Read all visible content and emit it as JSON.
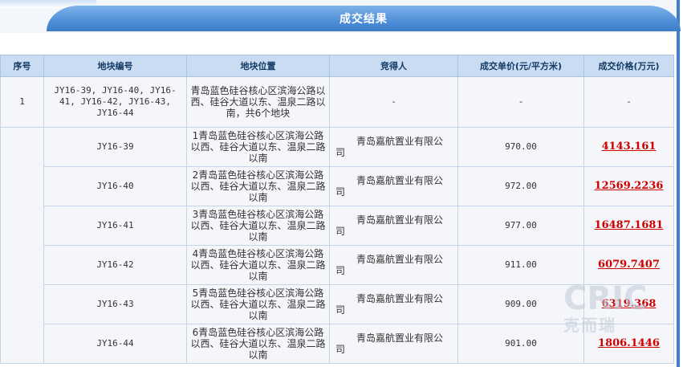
{
  "title": "成交结果",
  "columns": [
    "序号",
    "地块编号",
    "地块位置",
    "竞得人",
    "成交单价(元/平方米)",
    "成交价格(万元)"
  ],
  "summary_row": {
    "index": "1",
    "code": "JY16-39, JY16-40, JY16-41, JY16-42, JY16-43, JY16-44",
    "location": "青岛蓝色硅谷核心区滨海公路以西、硅谷大道以东、温泉二路以南，共6个地块",
    "bidder": "-",
    "unit_price": "-",
    "total_price": "-"
  },
  "rows": [
    {
      "code": "JY16-39",
      "location": "1青岛蓝色硅谷核心区滨海公路以西、硅谷大道以东、温泉二路以南",
      "bidder_name": "青岛嘉航置业有限公",
      "bidder_tail": "司",
      "unit_price": "970.00",
      "total_price": "4143.161"
    },
    {
      "code": "JY16-40",
      "location": "2青岛蓝色硅谷核心区滨海公路以西、硅谷大道以东、温泉二路以南",
      "bidder_name": "青岛嘉航置业有限公",
      "bidder_tail": "司",
      "unit_price": "972.00",
      "total_price": "12569.2236"
    },
    {
      "code": "JY16-41",
      "location": "3青岛蓝色硅谷核心区滨海公路以西、硅谷大道以东、温泉二路以南",
      "bidder_name": "青岛嘉航置业有限公",
      "bidder_tail": "司",
      "unit_price": "977.00",
      "total_price": "16487.1681"
    },
    {
      "code": "JY16-42",
      "location": "4青岛蓝色硅谷核心区滨海公路以西、硅谷大道以东、温泉二路以南",
      "bidder_name": "青岛嘉航置业有限公",
      "bidder_tail": "司",
      "unit_price": "911.00",
      "total_price": "6079.7407"
    },
    {
      "code": "JY16-43",
      "location": "5青岛蓝色硅谷核心区滨海公路以西、硅谷大道以东、温泉二路以南",
      "bidder_name": "青岛嘉航置业有限公",
      "bidder_tail": "司",
      "unit_price": "909.00",
      "total_price": "6319.368"
    },
    {
      "code": "JY16-44",
      "location": "6青岛蓝色硅谷核心区滨海公路以西、硅谷大道以东、温泉二路以南",
      "bidder_name": "青岛嘉航置业有限公",
      "bidder_tail": "司",
      "unit_price": "901.00",
      "total_price": "1806.1446"
    }
  ],
  "watermark": {
    "main": "CRIC",
    "sub": "克而瑞"
  },
  "colors": {
    "header_blue": "#4f8fd8",
    "link_red": "#cc0000",
    "table_head": "#c9dcf2"
  }
}
